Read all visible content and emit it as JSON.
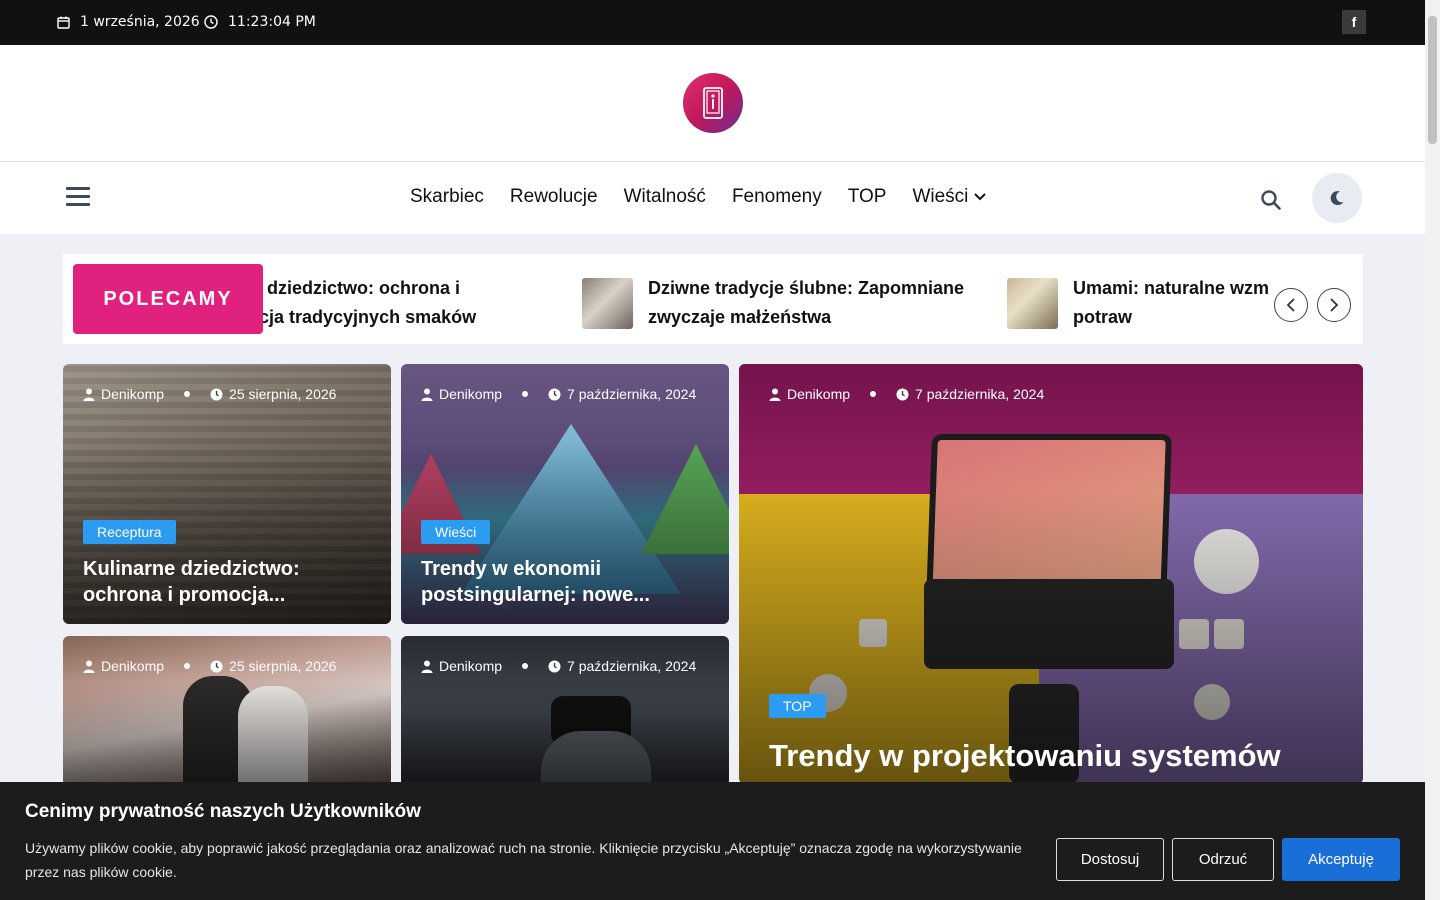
{
  "topbar": {
    "date": "1 września, 2026",
    "time": "11:23:04 PM",
    "social_icon": "facebook-icon"
  },
  "nav": {
    "items": [
      "Skarbiec",
      "Rewolucje",
      "Witalność",
      "Fenomeny",
      "TOP",
      "Wieści"
    ]
  },
  "ticker": {
    "badge": "POLECAMY",
    "items": [
      {
        "line1": "linarne dziedzictwo: ochrona i",
        "line2": "promocja tradycyjnych smaków"
      },
      {
        "line1": "Dziwne tradycje ślubne: Zapomniane",
        "line2": "zwyczaje małżeństwa"
      },
      {
        "line1": "Umami: naturalne wzmacniacze smaku",
        "line2": "potraw"
      }
    ]
  },
  "cards": [
    {
      "author": "Denikomp",
      "date": "25 sierpnia, 2026",
      "category": "Receptura",
      "title_line1": "Kulinarne dziedzictwo:",
      "title_line2": "ochrona i promocja..."
    },
    {
      "author": "Denikomp",
      "date": "7 października, 2024",
      "category": "Wieści",
      "title_line1": "Trendy w ekonomii",
      "title_line2": "postsingularnej: nowe..."
    },
    {
      "author": "Denikomp",
      "date": "7 października, 2024",
      "category": "TOP",
      "title_line1": "Trendy w projektowaniu systemów",
      "title_line2": ""
    },
    {
      "author": "Denikomp",
      "date": "25 sierpnia, 2026",
      "category": "",
      "title_line1": "",
      "title_line2": ""
    },
    {
      "author": "Denikomp",
      "date": "7 października, 2024",
      "category": "",
      "title_line1": "",
      "title_line2": ""
    }
  ],
  "cookie": {
    "title": "Cenimy prywatność naszych Użytkowników",
    "text": "Używamy plików cookie, aby poprawić jakość przeglądania oraz analizować ruch na stronie. Kliknięcie przycisku „Akceptuję” oznacza zgodę na wykorzystywanie przez nas plików cookie.",
    "customize": "Dostosuj",
    "reject": "Odrzuć",
    "accept": "Akceptuję"
  },
  "colors": {
    "accent_pink": "#e0217e",
    "category_blue": "#2c9cf2",
    "accept_blue": "#1a6ed8"
  }
}
